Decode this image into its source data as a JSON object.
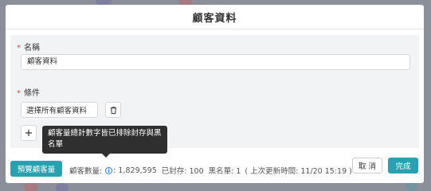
{
  "modal": {
    "title": "顧客資料"
  },
  "form": {
    "name_label": "名稱",
    "name_value": "顧客資料",
    "condition_label": "條件",
    "condition_select_value": "選擇所有顧客資料"
  },
  "tooltip": {
    "text": "顧客量總計數字皆已排除封存與黑名單"
  },
  "footer": {
    "preview_label": "預覽顧客量",
    "count_label": "顧客數量:",
    "count_value": ": 1,829,595",
    "archived": "已封存: 100",
    "blacklist": "黑名單: 1",
    "last_updated": "( 上次更新時間: 11/20 15:19 )",
    "cancel_label": "取 消",
    "done_label": "完成"
  },
  "icons": {
    "condition_select": "chevron-down-icon",
    "delete_condition": "trash-icon",
    "add_condition": "plus-icon",
    "info": "info-icon"
  },
  "colors": {
    "accent": "#2aa1b0",
    "required": "#e0483e",
    "info": "#2a7de1",
    "tooltip_bg": "#2f2f2f"
  }
}
